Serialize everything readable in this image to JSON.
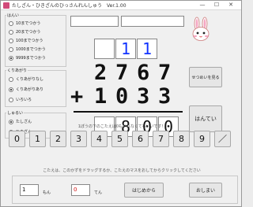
{
  "window": {
    "title": "たしざん・ひきざんのひっさんれんしゅう　Ver.1.00",
    "minimize": "—",
    "maximize": "☐",
    "close": "✕"
  },
  "settings": {
    "range_title": "はんい",
    "range_options": [
      {
        "label": "10までつかう",
        "checked": false
      },
      {
        "label": "20までつかう",
        "checked": false
      },
      {
        "label": "100までつかう",
        "checked": false
      },
      {
        "label": "1000までつかう",
        "checked": false
      },
      {
        "label": "9999までつかう",
        "checked": true
      }
    ],
    "carry_title": "くりあがり",
    "carry_options": [
      {
        "label": "くりあがりなし",
        "checked": false
      },
      {
        "label": "くりあがりあり",
        "checked": true
      },
      {
        "label": "いろいろ",
        "checked": false
      }
    ],
    "type_title": "しゅるい",
    "type_options": [
      {
        "label": "たしざん",
        "checked": true
      },
      {
        "label": "ひきざん",
        "checked": false
      }
    ]
  },
  "top_inputs": {
    "left_value": "",
    "right_value": ""
  },
  "icons": {
    "app": "rabbit-app-icon",
    "mascot": "rabbit-icon"
  },
  "problem": {
    "carry_boxes": [
      "",
      "1",
      "1"
    ],
    "first_number": [
      "2",
      "7",
      "6",
      "7"
    ],
    "operator": "+",
    "second_number": [
      "1",
      "0",
      "3",
      "3"
    ],
    "answer_boxes": [
      "",
      "8",
      "0",
      "0"
    ]
  },
  "buttons": {
    "explain": "せつめいを見る",
    "judge": "はんてい",
    "start": "はじめから",
    "finish": "おしまい"
  },
  "hints": {
    "top": "1ぽうの下のこたえは0もいれなくてもいいです！",
    "bottom": "こたえは、このかずをドラッグするか、こたえのマスをおしてからクリックしてください"
  },
  "keypad": [
    "0",
    "1",
    "2",
    "3",
    "4",
    "5",
    "6",
    "7",
    "8",
    "9",
    "／"
  ],
  "score": {
    "questions_value": "1",
    "questions_label": "もん",
    "points_value": "0",
    "points_label": "てん"
  },
  "colors": {
    "carry_digit": "#1133ff",
    "points_digit": "#d11111",
    "answer_digit": "#111111"
  }
}
